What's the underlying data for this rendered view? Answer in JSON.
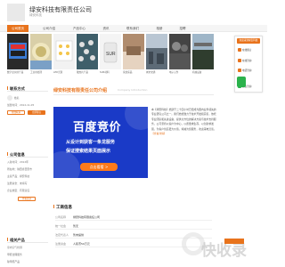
{
  "header": {
    "company_name": "绿安科技有限责任公司",
    "company_sub": "绿安科技"
  },
  "nav": {
    "items": [
      {
        "label": "公司首页",
        "active": true
      },
      {
        "label": "公司介绍",
        "active": false
      },
      {
        "label": "产品中心",
        "active": false
      },
      {
        "label": "资讯",
        "active": false
      },
      {
        "label": "联系我们",
        "active": false
      },
      {
        "label": "相册",
        "active": false
      },
      {
        "label": "招聘",
        "active": false
      }
    ]
  },
  "gallery": [
    {
      "caption": "数字显示屏产品"
    },
    {
      "caption": "工业水处理"
    },
    {
      "caption": "LED光源"
    },
    {
      "caption": "散热片产品"
    },
    {
      "caption": "SUR材料"
    },
    {
      "caption": "家纺床品"
    },
    {
      "caption": "城市交通"
    },
    {
      "caption": "电子元件"
    },
    {
      "caption": "机械设备"
    }
  ],
  "float_panel": {
    "head": "欢迎来到绿安科技",
    "rows": [
      "在线留言",
      "在线咨询",
      "电话咨询",
      "微信咨询"
    ]
  },
  "sidebar": {
    "contact_title": "联系方式",
    "contact_name": "姓名",
    "contact_date": "加盟时间：2012-11-05",
    "btn_contact": "在线联系",
    "btn_message": "立即留言",
    "company_title": "公司信息",
    "info_lines": [
      "入驻时间：2012年",
      "所在地：陕西省西安市",
      "主营产品：绿安科技",
      "注册资金：未填写",
      "企业类型：有限责任"
    ],
    "info_btn": "查看更多",
    "products_title": "相关产品",
    "product_lines": [
      "室内空气检测",
      "甲醛治理服务",
      "除甲醛产品"
    ]
  },
  "main": {
    "title": "绿安科技有限责任公司介绍",
    "title_sub": "Company Introduction",
    "banner": {
      "title": "百度竞价",
      "line1": "从设计到获客一条龙服务",
      "line2": "保证搜索结果页面展示",
      "button": "点击看看 >"
    },
    "intro": "本【绿安科技】始建于二十四小时已经成为国内业界领先的专业研究公司之一。我们始终致力于技术开发和完善，依托专业团队和先进设备，提供全方位的解决方案与技术支持服务，公司坚持以客户为中心，以质量求生存，以创新求发展，为客户创造更大价值，竭诚为您服务，欢迎来电洽谈。",
    "intro_more": "【查看详情】",
    "biz_title": "工商信息",
    "biz_rows": [
      {
        "label": "公司名称",
        "value": "绿安科技有限责任公司"
      },
      {
        "label": "统一社会",
        "value": "暂无"
      },
      {
        "label": "法定代表人",
        "value": "暂未提供"
      },
      {
        "label": "注册资金",
        "value": "人民币50万元"
      }
    ]
  },
  "watermark": {
    "text": "快收录"
  },
  "colors": {
    "accent": "#e8731c",
    "banner_blue": "#1a3ac7",
    "wechat_green": "#2bb24c"
  }
}
